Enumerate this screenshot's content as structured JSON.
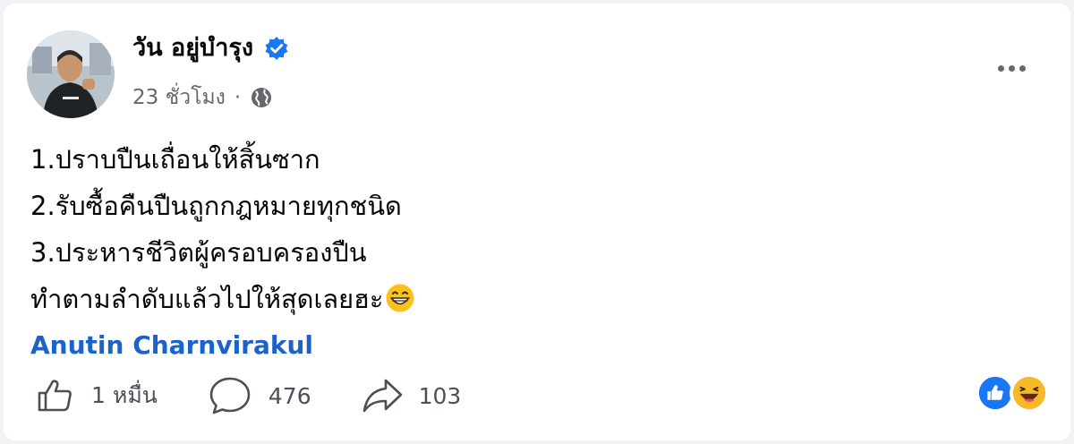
{
  "post": {
    "author_name": "วัน อยู่บำรุง",
    "time": "23 ชั่วโมง",
    "separator": "·",
    "lines": [
      "1.ปราบปืนเถื่อนให้สิ้นซาก",
      "2.รับซื้อคืนปืนถูกกฎหมายทุกชนิด",
      "3.ประหารชีวิตผู้ครอบครองปืน",
      "ทำตามลำดับแล้วไปให้สุดเลยฮะ"
    ],
    "mention": "Anutin Charnvirakul"
  },
  "stats": {
    "likes": "1 หมื่น",
    "comments": "476",
    "shares": "103"
  },
  "icons": {
    "verified": "verified-badge-icon",
    "privacy": "globe-icon",
    "more": "more-options-icon",
    "like": "like-thumb-icon",
    "comment": "comment-bubble-icon",
    "share": "share-arrow-icon"
  },
  "colors": {
    "accent": "#1b62c9",
    "verified": "#1877f2",
    "muted_text": "#65676b",
    "like_reaction": "#1877f2",
    "haha_reaction": "#f7b928"
  }
}
